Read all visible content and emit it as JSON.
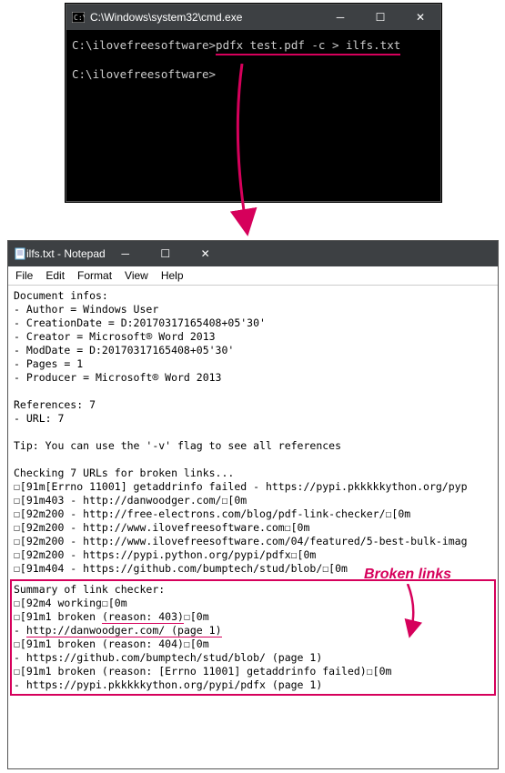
{
  "cmd": {
    "title": "C:\\Windows\\system32\\cmd.exe",
    "prompt1": "C:\\ilovefreesoftware>",
    "command": "pdfx test.pdf -c > ilfs.txt",
    "prompt2": "C:\\ilovefreesoftware>"
  },
  "notepad": {
    "title": "ilfs.txt - Notepad",
    "menu": {
      "file": "File",
      "edit": "Edit",
      "format": "Format",
      "view": "View",
      "help": "Help"
    },
    "lines": {
      "l0": "Document infos:",
      "l1": "- Author = Windows User",
      "l2": "- CreationDate = D:20170317165408+05'30'",
      "l3": "- Creator = Microsoft® Word 2013",
      "l4": "- ModDate = D:20170317165408+05'30'",
      "l5": "- Pages = 1",
      "l6": "- Producer = Microsoft® Word 2013",
      "l7": "References: 7",
      "l8": "- URL: 7",
      "l9": "Tip: You can use the '-v' flag to see all references",
      "l10": "Checking 7 URLs for broken links...",
      "l11": "☐[91m[Errno 11001] getaddrinfo failed - https://pypi.pkkkkkython.org/pyp",
      "l12": "☐[91m403 - http://danwoodger.com/☐[0m",
      "l13": "☐[92m200 - http://free-electrons.com/blog/pdf-link-checker/☐[0m",
      "l14": "☐[92m200 - http://www.ilovefreesoftware.com☐[0m",
      "l15": "☐[92m200 - http://www.ilovefreesoftware.com/04/featured/5-best-bulk-imag",
      "l16": "☐[92m200 - https://pypi.python.org/pypi/pdfx☐[0m",
      "l17": "☐[91m404 - https://github.com/bumptech/stud/blob/☐[0m"
    },
    "summary": {
      "s0": "Summary of link checker:",
      "s1": "☐[92m4 working☐[0m",
      "s2a": "☐[91m1 broken ",
      "s2b": "(reason: 403)",
      "s2c": "☐[0m",
      "s3a": "   - ",
      "s3b": "http://danwoodger.com/ (page 1)",
      "s4": "☐[91m1 broken (reason: 404)☐[0m",
      "s5": "   - https://github.com/bumptech/stud/blob/ (page 1)",
      "s6": "☐[91m1 broken (reason: [Errno 11001] getaddrinfo failed)☐[0m",
      "s7": "   - https://pypi.pkkkkkython.org/pypi/pdfx (page 1)"
    }
  },
  "annotation": "Broken links"
}
